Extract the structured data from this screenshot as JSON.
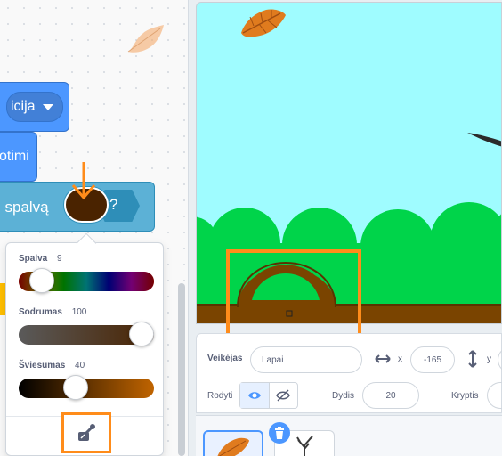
{
  "code_area": {
    "position_block_label": "icija",
    "options_block_label": "otimi",
    "sensing_block_label": "i spalvą",
    "sensing_block_end": "?"
  },
  "color_picker": {
    "hue_label": "Spalva",
    "hue_value": "9",
    "saturation_label": "Sodrumas",
    "saturation_value": "100",
    "brightness_label": "Šviesumas",
    "brightness_value": "40",
    "selected_color": "#4a2300"
  },
  "sprite_info": {
    "sprite_label": "Veikėjas",
    "sprite_name": "Lapai",
    "x_label": "x",
    "x_value": "-165",
    "y_label": "y",
    "show_label": "Rodyti",
    "size_label": "Dydis",
    "size_value": "20",
    "direction_label": "Kryptis"
  },
  "colors": {
    "accent_orange": "#ff8c1a",
    "motion_blue": "#4c97ff",
    "sensing_cyan": "#5cb1d6",
    "stage_sky": "#9ffcff",
    "bush_green": "#00d44a",
    "ground_brown": "#7a4400"
  },
  "icons": [
    "leaf-icon",
    "down-arrow-annotation",
    "eyedropper-icon",
    "eye-icon",
    "eye-slash-icon",
    "horizontal-arrows-icon",
    "vertical-arrows-icon",
    "trash-icon",
    "tree-icon"
  ]
}
